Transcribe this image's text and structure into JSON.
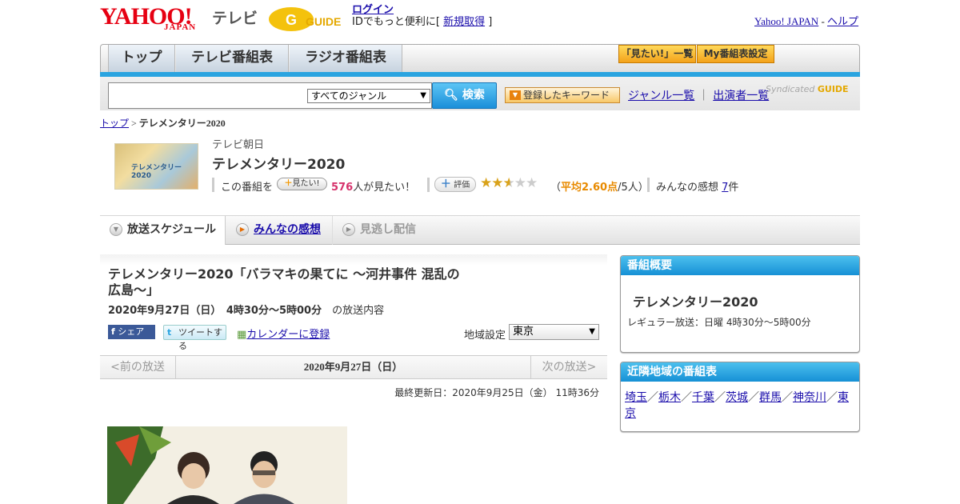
{
  "header": {
    "logo": "YAHOO!",
    "logo_sub": "JAPAN",
    "logo_service": "テレビ",
    "gguide_logo": "GUIDE",
    "login": "ログイン",
    "login_prefix": "IDでもっと便利に[ ",
    "signup": "新規取得",
    "login_suffix": " ]",
    "yahoo_japan": "Yahoo! JAPAN",
    "dash": " - ",
    "help": "ヘルプ"
  },
  "nav": {
    "tabs": [
      "トップ",
      "テレビ番組表",
      "ラジオ番組表"
    ],
    "watchlist": "「見たい!」一覧",
    "my_schedule": "My番組表設定"
  },
  "search": {
    "genre": "すべてのジャンル",
    "button": "検索",
    "keyword_btn": "登録したキーワード",
    "genre_list": "ジャンル一覧",
    "divider": "｜",
    "cast_list": "出演者一覧",
    "syndicated": "Syndicated",
    "colors": {
      "accent": "#2aa4e0",
      "button": "#1b8fd9"
    }
  },
  "breadcrumb": {
    "home": "トップ",
    "sep": " > ",
    "current": "テレメンタリー2020"
  },
  "program": {
    "thumb_text": "テレメンタリー2020",
    "station": "テレビ朝日",
    "title": "テレメンタリー2020",
    "want_prefix": "この番組を",
    "want_btn": "見たい!",
    "want_count": "576",
    "want_suffix": "人が見たい！",
    "rate_btn": "評価",
    "rating_stars": 2.6,
    "avg_label": "平均2.60点",
    "voters": "/5人）",
    "open_paren": "（",
    "reviews_prefix": "みんなの感想 ",
    "reviews_count": "7",
    "reviews_suffix": "件"
  },
  "tabs": [
    "放送スケジュール",
    "みんなの感想",
    "見逃し配信"
  ],
  "episode": {
    "title": "テレメンタリー2020「バラマキの果てに ～河井事件 混乱の広島～」",
    "air_time": "2020年9月27日（日）　4時30分～5時00分",
    "air_suffix": "の放送内容",
    "share_fb": "シェア",
    "share_tw": "ツイートする",
    "calendar": "カレンダーに登録",
    "region_label": "地域設定",
    "region": "東京",
    "prev": "<前の放送",
    "date": "2020年9月27日（日）",
    "next": "次の放送>",
    "updated": "最終更新日：2020年9月25日（金）  11時36分"
  },
  "overview": {
    "heading": "番組概要",
    "title": "テレメンタリー2020",
    "regular": "レギュラー放送：日曜 4時30分～5時00分"
  },
  "nearby": {
    "heading": "近隣地域の番組表",
    "areas": [
      "埼玉",
      "栃木",
      "千葉",
      "茨城",
      "群馬",
      "神奈川",
      "東京"
    ],
    "separator": "／"
  }
}
